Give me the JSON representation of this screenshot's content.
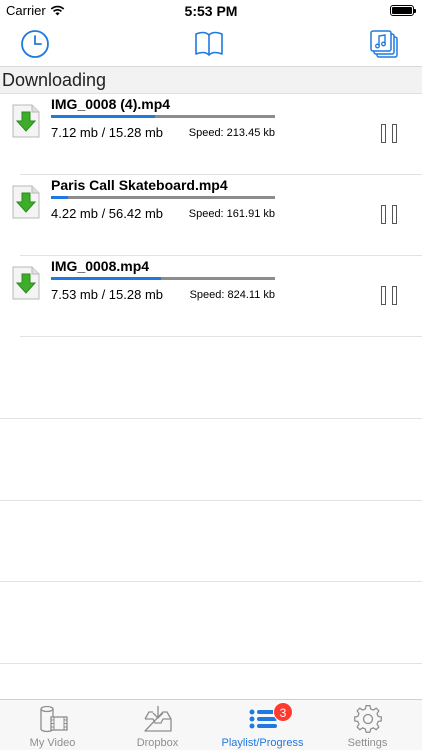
{
  "status_bar": {
    "carrier": "Carrier",
    "time": "5:53 PM"
  },
  "toolbar": {
    "left_icon": "clock-icon",
    "center_icon": "book-icon",
    "right_icon": "music-playlist-icon"
  },
  "section": {
    "title": "Downloading"
  },
  "downloads": [
    {
      "name": "IMG_0008 (4).mp4",
      "sizes": "7.12 mb / 15.28 mb",
      "speed": "Speed: 213.45 kb",
      "progress": 0.466
    },
    {
      "name": "Paris Call Skateboard.mp4",
      "sizes": "4.22 mb / 56.42 mb",
      "speed": "Speed: 161.91 kb",
      "progress": 0.075
    },
    {
      "name": "IMG_0008.mp4",
      "sizes": "7.53 mb / 15.28 mb",
      "speed": "Speed: 824.11 kb",
      "progress": 0.493
    }
  ],
  "tabs": [
    {
      "label": "My Video",
      "icon": "video-reel-icon",
      "active": false
    },
    {
      "label": "Dropbox",
      "icon": "inbox-download-icon",
      "active": false
    },
    {
      "label": "Playlist/Progress",
      "icon": "list-icon",
      "active": true,
      "badge": "3"
    },
    {
      "label": "Settings",
      "icon": "gear-icon",
      "active": false
    }
  ],
  "colors": {
    "accent": "#1f7ae0",
    "badge": "#ff3b30",
    "download_green": "#3cae2a"
  }
}
